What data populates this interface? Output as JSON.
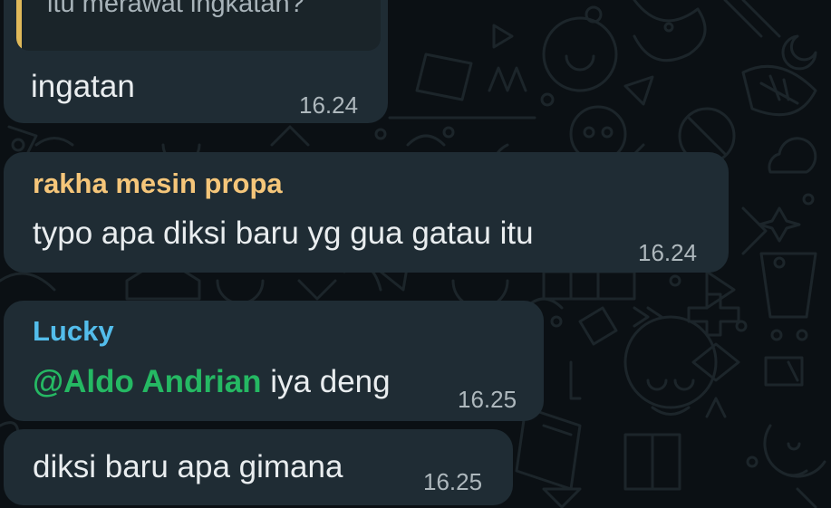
{
  "colors": {
    "background": "#0b1014",
    "bubble": "#1f2c34",
    "reply_bar": "#e0b95a",
    "sender_rakha": "#f5c67a",
    "sender_lucky": "#53bdeb",
    "mention": "#25b863"
  },
  "messages": [
    {
      "reply_text": "itu merawat ingkatan?",
      "text": "ingatan",
      "time": "16.24"
    },
    {
      "sender": "rakha mesin propa",
      "text": "typo apa diksi baru yg gua gatau itu",
      "time": "16.24"
    },
    {
      "sender": "Lucky",
      "mention": "@Aldo Andrian",
      "text": " iya deng",
      "time": "16.25"
    },
    {
      "text": "diksi baru apa gimana",
      "time": "16.25"
    }
  ]
}
